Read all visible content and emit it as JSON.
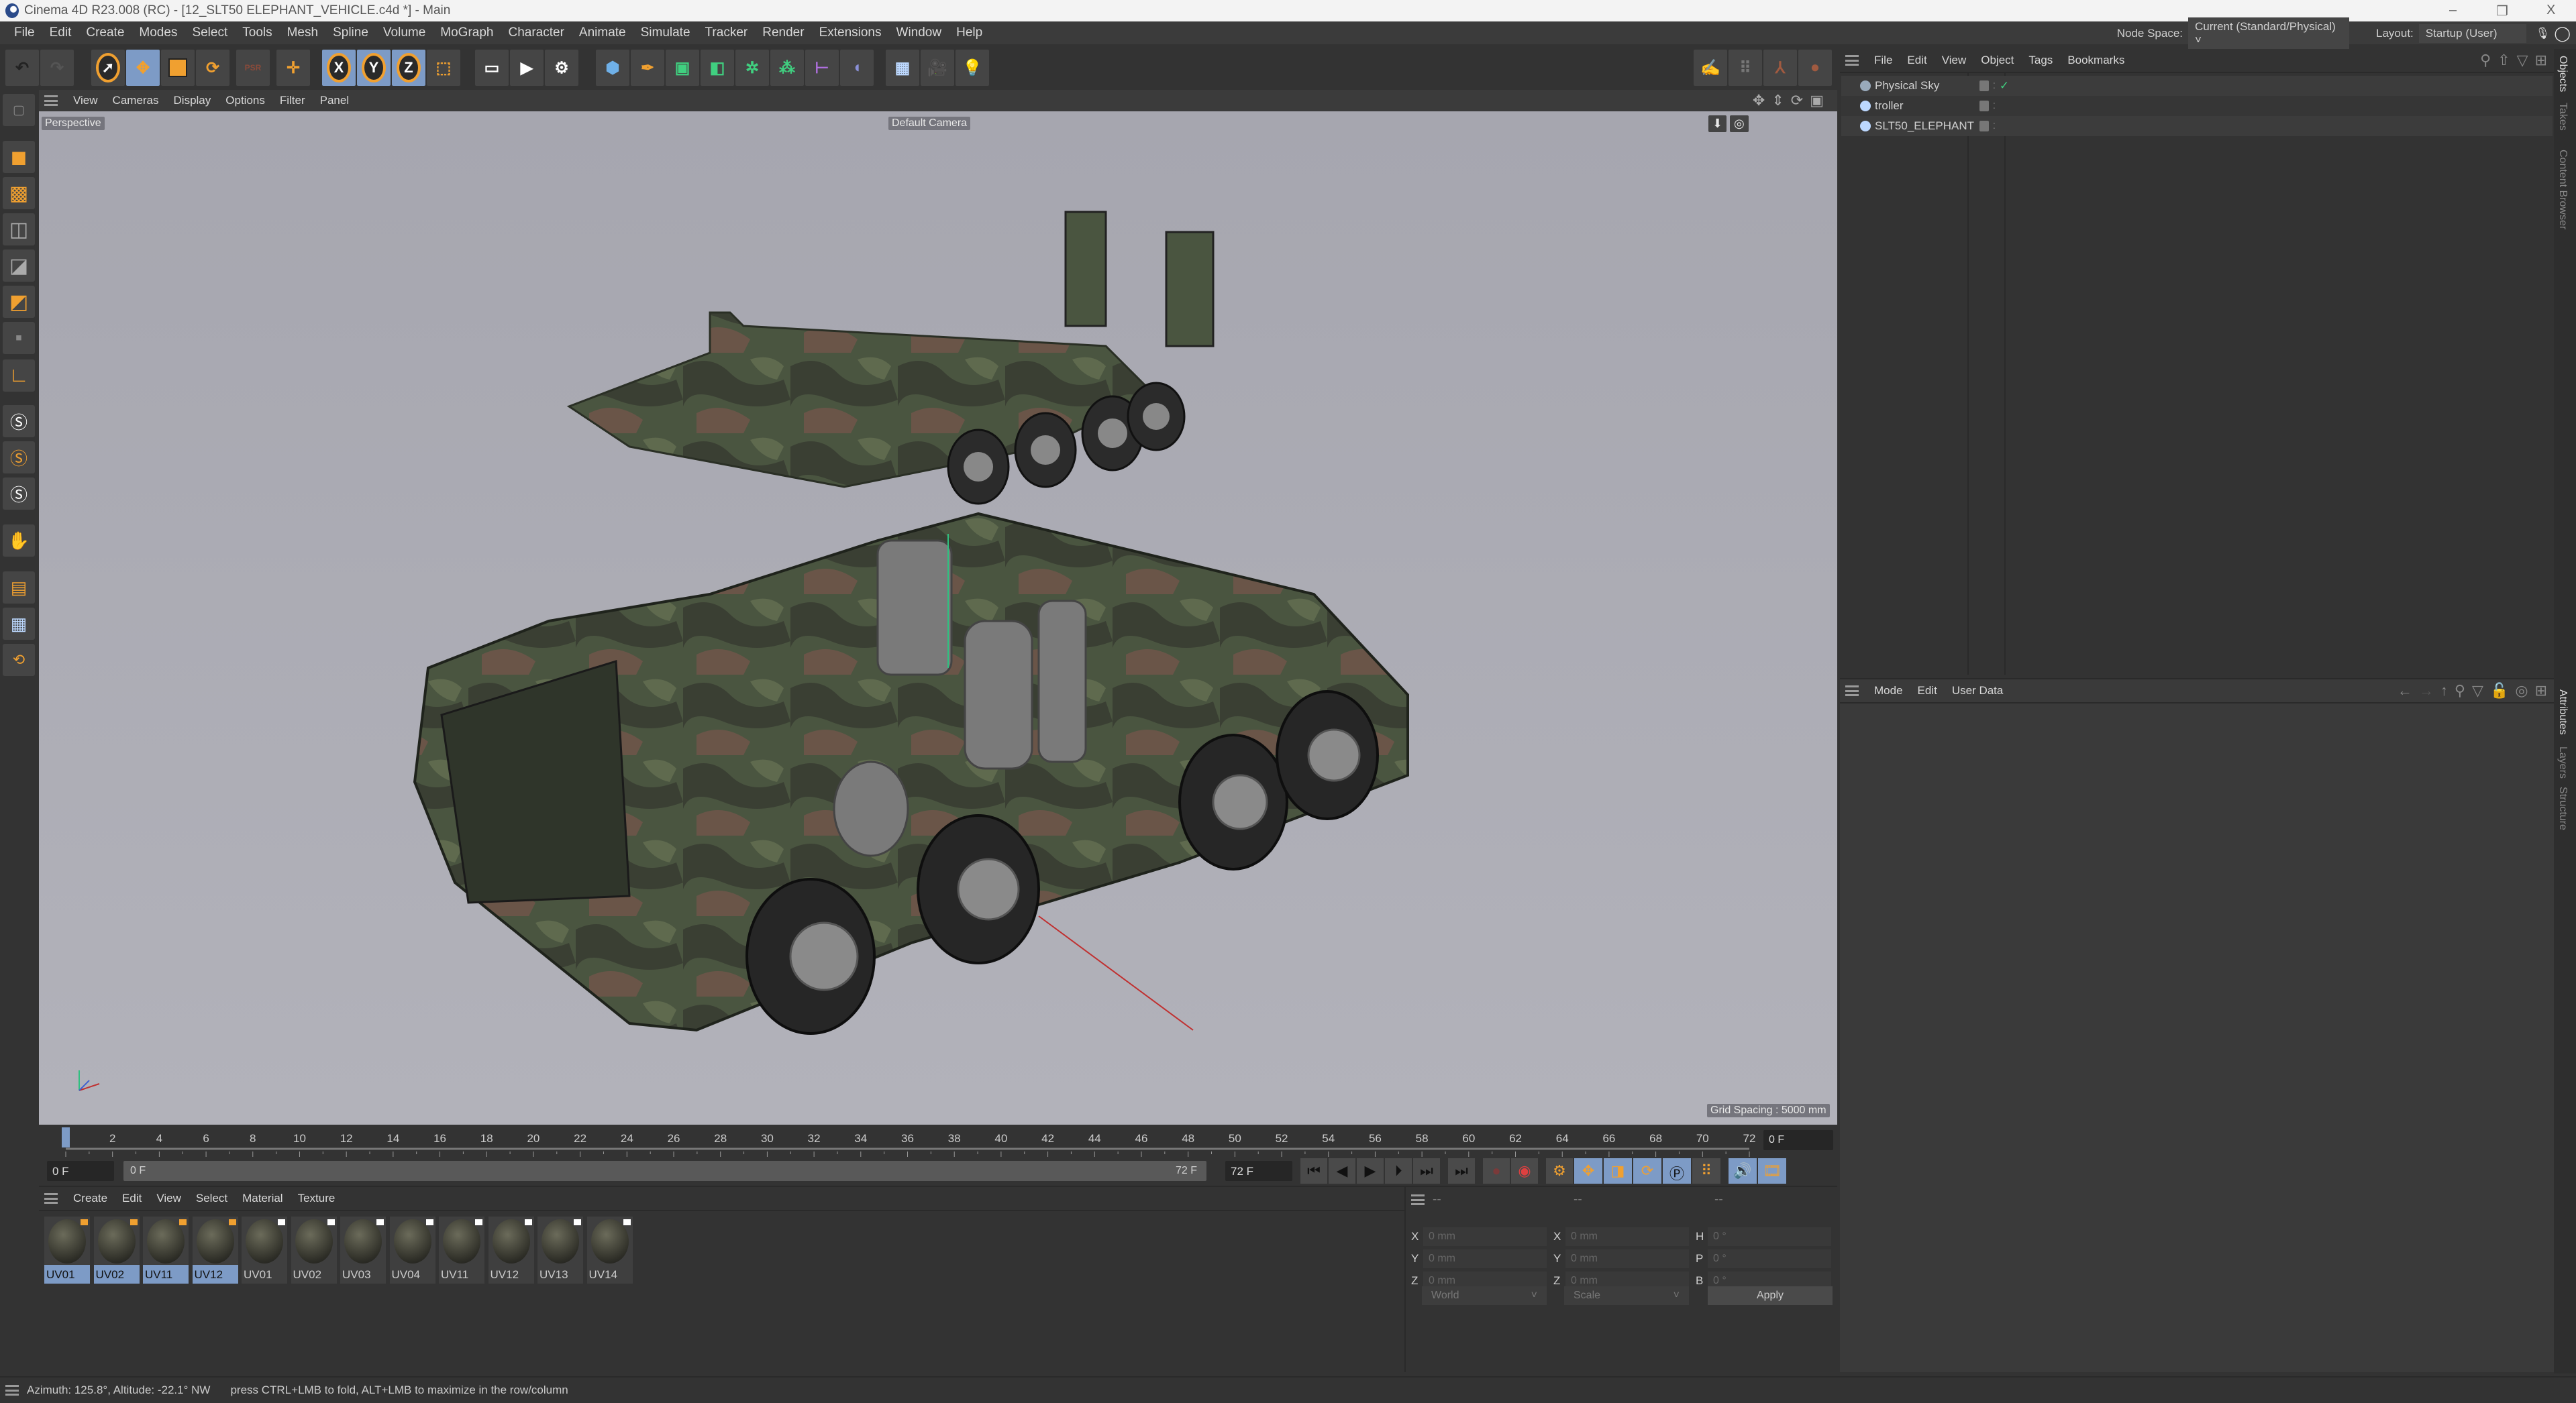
{
  "window": {
    "title": "Cinema 4D R23.008 (RC) - [12_SLT50 ELEPHANT_VEHICLE.c4d *] - Main",
    "minimize": "–",
    "restore": "❐",
    "close": "X"
  },
  "menu": [
    "File",
    "Edit",
    "Create",
    "Modes",
    "Select",
    "Tools",
    "Mesh",
    "Spline",
    "Volume",
    "MoGraph",
    "Character",
    "Animate",
    "Simulate",
    "Tracker",
    "Render",
    "Extensions",
    "Window",
    "Help"
  ],
  "header": {
    "node_space_label": "Node Space:",
    "node_space_value": "Current (Standard/Physical)",
    "layout_label": "Layout:",
    "layout_value": "Startup (User)"
  },
  "toolbar": {
    "x": "X",
    "y": "Y",
    "z": "Z",
    "psr": "PSR"
  },
  "viewport": {
    "menu": [
      "View",
      "Cameras",
      "Display",
      "Options",
      "Filter",
      "Panel"
    ],
    "view_name": "Perspective",
    "camera": "Default Camera",
    "grid_spacing": "Grid Spacing : 5000 mm"
  },
  "timeline": {
    "start": 0,
    "end": 72,
    "step": 2,
    "current": 0,
    "current_field": "0 F",
    "range_start": "0 F",
    "range_start_inner": "0 F",
    "range_end_inner": "72 F",
    "range_end": "72 F"
  },
  "materials": {
    "menu": [
      "Create",
      "Edit",
      "View",
      "Select",
      "Material",
      "Texture"
    ],
    "items": [
      {
        "name": "UV01",
        "selected": true
      },
      {
        "name": "UV02",
        "selected": true
      },
      {
        "name": "UV11",
        "selected": true
      },
      {
        "name": "UV12",
        "selected": true
      },
      {
        "name": "UV01",
        "selected": false
      },
      {
        "name": "UV02",
        "selected": false
      },
      {
        "name": "UV03",
        "selected": false
      },
      {
        "name": "UV04",
        "selected": false
      },
      {
        "name": "UV11",
        "selected": false
      },
      {
        "name": "UV12",
        "selected": false
      },
      {
        "name": "UV13",
        "selected": false
      },
      {
        "name": "UV14",
        "selected": false
      }
    ]
  },
  "coordinates": {
    "headers": [
      "--",
      "--",
      "--"
    ],
    "rows": [
      {
        "l1": "X",
        "v1": "0 mm",
        "l2": "X",
        "v2": "0 mm",
        "l3": "H",
        "v3": "0 °"
      },
      {
        "l1": "Y",
        "v1": "0 mm",
        "l2": "Y",
        "v2": "0 mm",
        "l3": "P",
        "v3": "0 °"
      },
      {
        "l1": "Z",
        "v1": "0 mm",
        "l2": "Z",
        "v2": "0 mm",
        "l3": "B",
        "v3": "0 °"
      }
    ],
    "space": "World",
    "mode": "Scale",
    "apply": "Apply"
  },
  "objects": {
    "menu": [
      "File",
      "Edit",
      "View",
      "Object",
      "Tags",
      "Bookmarks"
    ],
    "items": [
      {
        "name": "Physical Sky",
        "check": "✓"
      },
      {
        "name": "troller",
        "check": ""
      },
      {
        "name": "SLT50_ELEPHANT",
        "check": ""
      }
    ]
  },
  "attributes": {
    "menu": [
      "Mode",
      "Edit",
      "User Data"
    ]
  },
  "side_tabs": {
    "top": [
      "Objects",
      "Takes",
      "Content Browser"
    ],
    "bottom": [
      "Attributes",
      "Layers",
      "Structure"
    ]
  },
  "status": {
    "left": "Azimuth: 125.8°, Altitude: -22.1°  NW",
    "right": "press CTRL+LMB to fold, ALT+LMB to maximize in the row/column"
  },
  "colors": {
    "accent": "#7d9bc6",
    "orange": "#f0a030",
    "viewport": "#ababb4"
  }
}
